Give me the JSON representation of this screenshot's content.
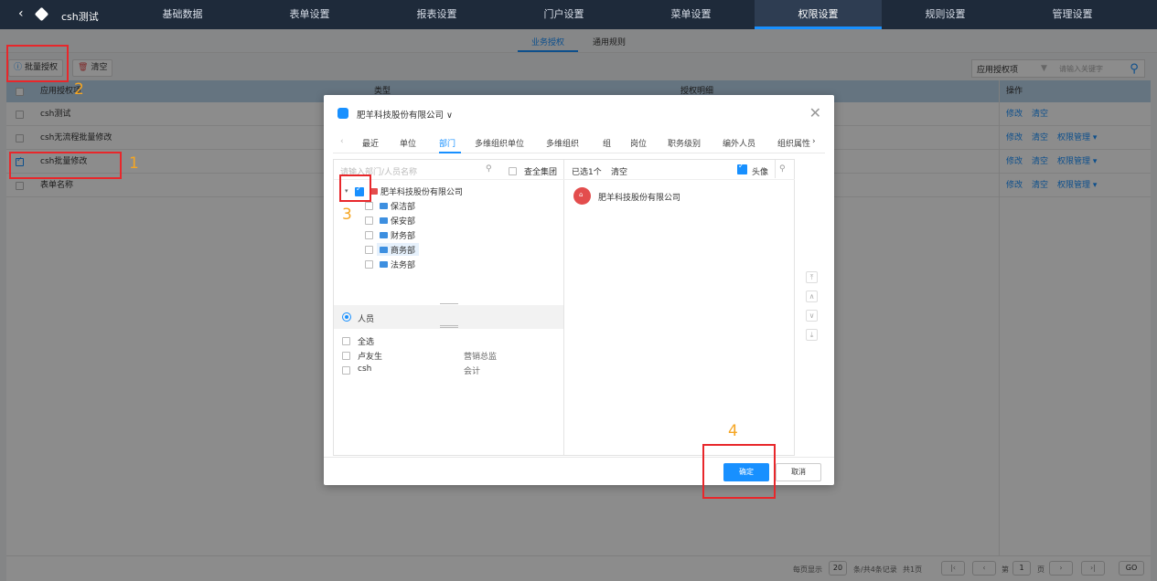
{
  "app": {
    "title": "csh测试"
  },
  "nav": {
    "items": [
      "基础数据",
      "表单设置",
      "报表设置",
      "门户设置",
      "菜单设置",
      "权限设置",
      "规则设置",
      "管理设置"
    ],
    "active": "权限设置"
  },
  "subtabs": {
    "tab1": "业务授权",
    "tab2": "通用规则"
  },
  "toolbar": {
    "batch": "批量授权",
    "clear": "清空",
    "select_label": "应用授权项",
    "keyword_placeholder": "请输入关键字"
  },
  "table": {
    "headers": {
      "name": "应用授权项",
      "type": "类型",
      "detail": "授权明细",
      "ops": "操作"
    },
    "rows": [
      {
        "name": "csh测试",
        "op1": "修改",
        "op2": "清空",
        "op3": ""
      },
      {
        "name": "csh无流程批量修改",
        "op1": "修改",
        "op2": "清空",
        "op3": "权限管理 ▾"
      },
      {
        "name": "csh批量修改",
        "op1": "修改",
        "op2": "清空",
        "op3": "权限管理 ▾"
      },
      {
        "name": "表单名称",
        "op1": "修改",
        "op2": "清空",
        "op3": "权限管理 ▾"
      }
    ]
  },
  "pager": {
    "per_page_label": "每页显示",
    "per_page": "20",
    "total": "条/共4条记录",
    "pages": "共1页",
    "page_label": "第",
    "page": "1",
    "page_unit": "页",
    "go": "GO"
  },
  "dialog": {
    "title": "肥羊科技股份有限公司 ∨",
    "tabs": [
      "最近",
      "单位",
      "部门",
      "多维组织单位",
      "多维组织",
      "组",
      "岗位",
      "职务级别",
      "编外人员",
      "组织属性"
    ],
    "active_tab": "部门",
    "search_placeholder": "请输入部门/人员名称",
    "all_group": "查全集团",
    "tree": {
      "root": "肥羊科技股份有限公司",
      "children": [
        "保洁部",
        "保安部",
        "财务部",
        "商务部",
        "法务部"
      ]
    },
    "person_section": "人员",
    "people": [
      {
        "name": "全选",
        "title": ""
      },
      {
        "name": "卢友生",
        "title": "营销总监"
      },
      {
        "name": "csh",
        "title": "会计"
      }
    ],
    "selected_count": "已选1个",
    "clear": "清空",
    "avatar_label": "头像",
    "selected": [
      "肥羊科技股份有限公司"
    ],
    "ok": "确定",
    "cancel": "取消"
  },
  "annotations": {
    "n1": "1",
    "n2": "2",
    "n3": "3",
    "n4": "4"
  },
  "colors": {
    "accent": "#1890ff",
    "nav_bg": "#1e2a3a",
    "highlight": "#e8272b",
    "step_number": "#f5a623"
  }
}
